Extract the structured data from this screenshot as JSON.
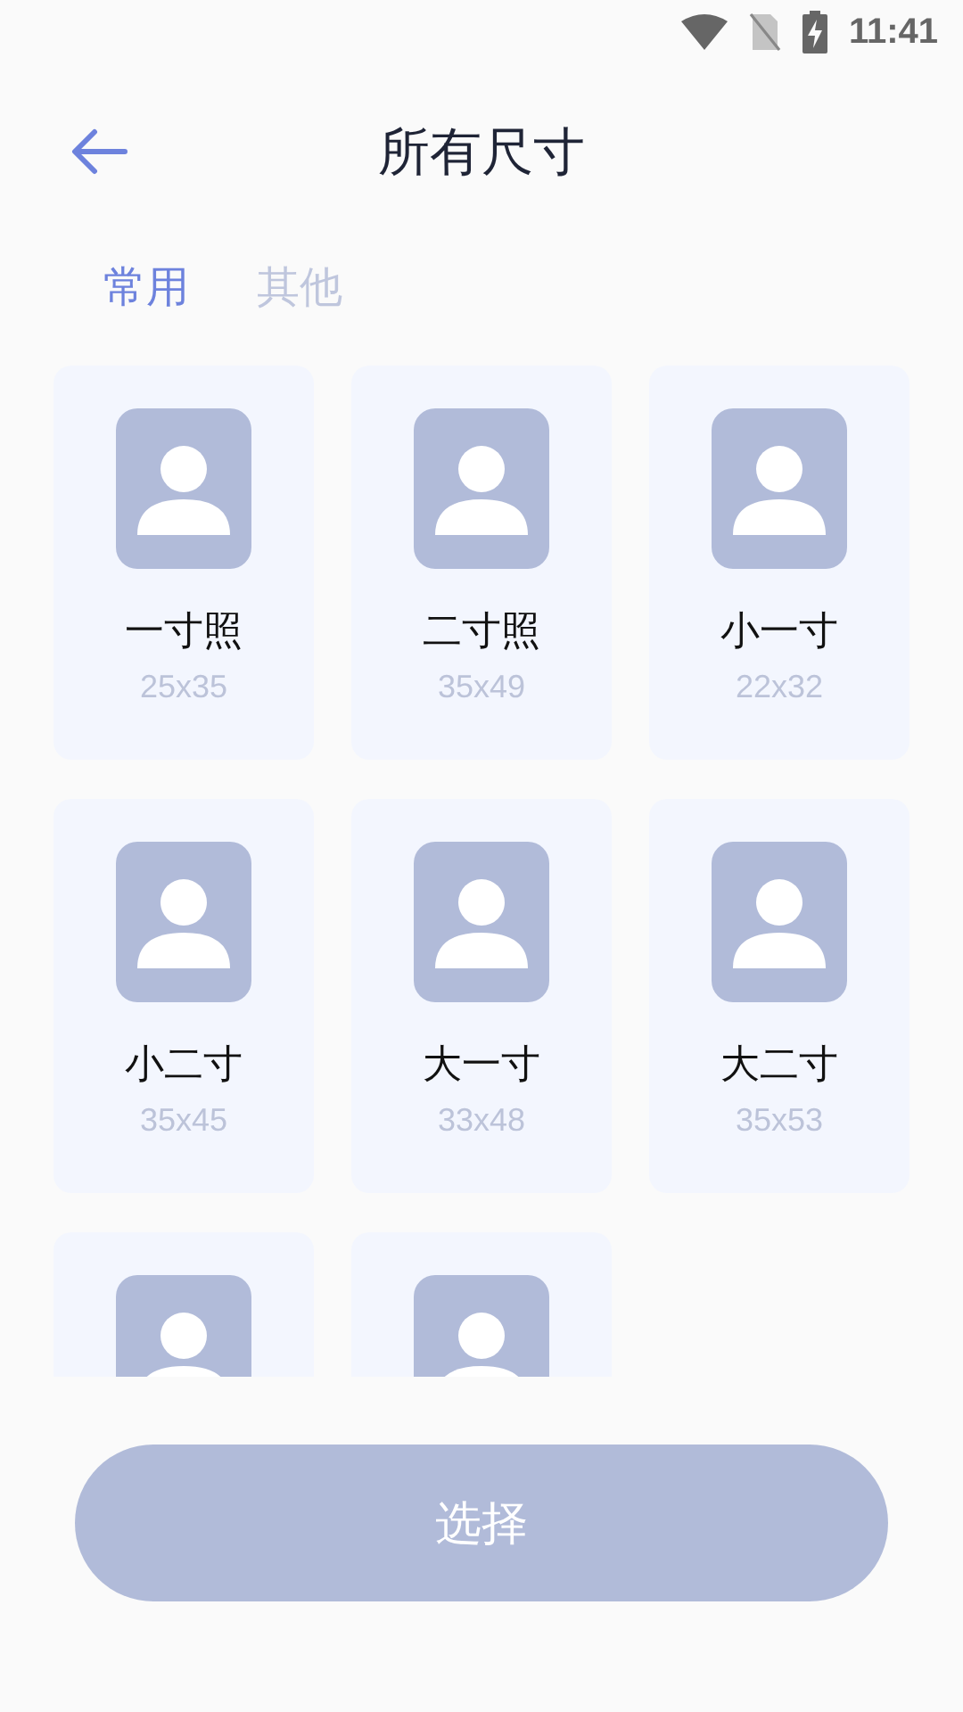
{
  "status_bar": {
    "time": "11:41"
  },
  "header": {
    "title": "所有尺寸"
  },
  "tabs": [
    {
      "label": "常用",
      "selected": true
    },
    {
      "label": "其他",
      "selected": false
    }
  ],
  "sizes": [
    {
      "kind": "full",
      "name": "一寸照",
      "dimensions": "25x35"
    },
    {
      "kind": "full",
      "name": "二寸照",
      "dimensions": "35x49"
    },
    {
      "kind": "full",
      "name": "小一寸",
      "dimensions": "22x32"
    },
    {
      "kind": "full",
      "name": "小二寸",
      "dimensions": "35x45"
    },
    {
      "kind": "full",
      "name": "大一寸",
      "dimensions": "33x48"
    },
    {
      "kind": "full",
      "name": "大二寸",
      "dimensions": "35x53"
    },
    {
      "kind": "partial"
    },
    {
      "kind": "partial"
    }
  ],
  "select_button": {
    "label": "选择"
  }
}
